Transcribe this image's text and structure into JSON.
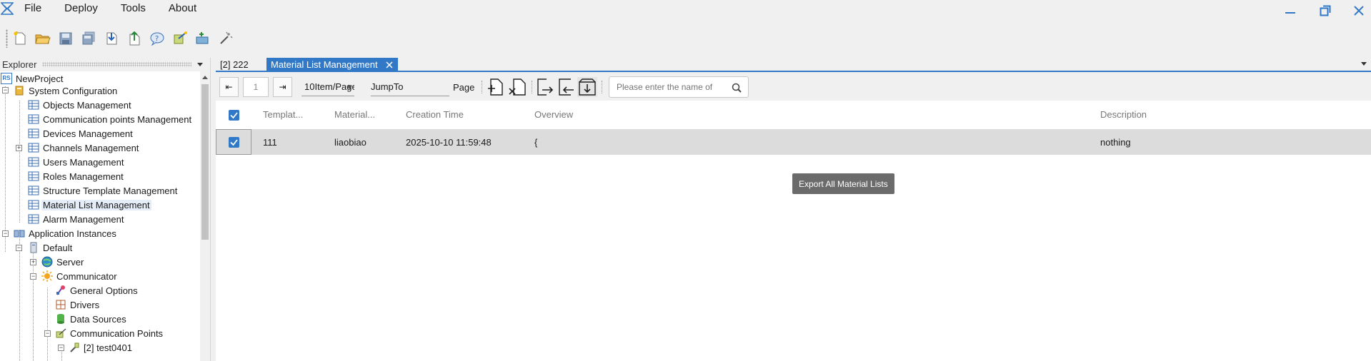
{
  "menu": {
    "items": [
      "File",
      "Deploy",
      "Tools",
      "About"
    ]
  },
  "window": {
    "minimize_icon": "minimize-icon",
    "restore_icon": "restore-icon",
    "close_icon": "close-icon"
  },
  "toolbar": {
    "buttons": [
      "new-project",
      "open-folder",
      "save",
      "save-all",
      "import",
      "export",
      "help",
      "publish",
      "add-device",
      "wizard"
    ]
  },
  "explorer": {
    "title": "Explorer",
    "tree": {
      "root": "NewProject",
      "root_badge": "RS",
      "system_configuration": "System Configuration",
      "items": [
        "Objects Management",
        "Communication points Management",
        "Devices Management",
        "Channels Management",
        "Users Management",
        "Roles Management",
        "Structure Template Management",
        "Material List Management",
        "Alarm Management"
      ],
      "application_instances": "Application Instances",
      "default": "Default",
      "server": "Server",
      "communicator": "Communicator",
      "communicator_children": [
        "General Options",
        "Drivers",
        "Data Sources"
      ],
      "communication_points": "Communication Points",
      "test_point": "[2] test0401"
    }
  },
  "tabs": [
    {
      "label": "[2] 222",
      "active": false
    },
    {
      "label": "Material List Management",
      "active": true
    }
  ],
  "pager": {
    "first": "⇤",
    "page": "1",
    "last": "⇥",
    "page_size": "10Item/Page",
    "jump_label": "JumpTo",
    "page_label": "Page"
  },
  "search": {
    "placeholder": "Please enter the name of"
  },
  "grid": {
    "columns": [
      "Templat...",
      "Material...",
      "Creation Time",
      "Overview",
      "Description"
    ],
    "rows": [
      {
        "checked": true,
        "template": "111",
        "material": "liaobiao",
        "creation_time": "2025-10-10 11:59:48",
        "overview": "{",
        "description": "nothing"
      }
    ]
  },
  "tooltip": "Export All Material Lists",
  "colors": {
    "accent": "#3178c6",
    "selected_row": "#dcdcdc",
    "tooltip_bg": "#6b6b6b"
  }
}
